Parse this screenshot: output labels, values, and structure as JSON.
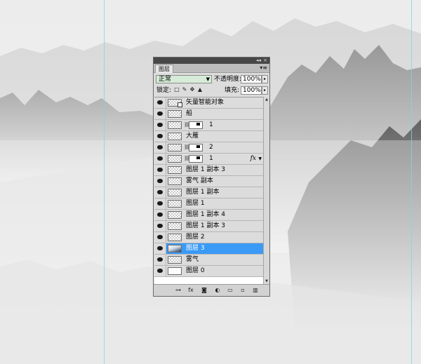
{
  "panel": {
    "tab_label": "图层",
    "collapse_glyph": "◂◂",
    "close_glyph": "×",
    "menu_glyph": "▾≡",
    "blend_mode": "正常",
    "opacity_label": "不透明度:",
    "opacity_value": "100%",
    "lock_label": "锁定:",
    "fill_label": "填充:",
    "fill_value": "100%"
  },
  "icons": {
    "lock_transparent": "□",
    "lock_paint": "✎",
    "lock_move": "✥",
    "lock_all": "▲",
    "bottom": [
      "⊶",
      "fx",
      "◙",
      "◐",
      "▭",
      "▫",
      "▥"
    ]
  },
  "layers": [
    {
      "name": "矢量智能对象",
      "type": "smart"
    },
    {
      "name": "船",
      "type": "normal"
    },
    {
      "name": "1",
      "type": "masked"
    },
    {
      "name": "大雁",
      "type": "normal"
    },
    {
      "name": "2",
      "type": "masked"
    },
    {
      "name": "1",
      "type": "masked",
      "fx": "fx"
    },
    {
      "name": "图层 1 副本 3",
      "type": "normal"
    },
    {
      "name": "雾气 副本",
      "type": "normal"
    },
    {
      "name": "图层 1 副本",
      "type": "normal"
    },
    {
      "name": "图层 1",
      "type": "normal"
    },
    {
      "name": "图层 1 副本 4",
      "type": "normal"
    },
    {
      "name": "图层 1 副本 3",
      "type": "normal"
    },
    {
      "name": "图层 2",
      "type": "normal"
    },
    {
      "name": "图层 3",
      "type": "image",
      "selected": true
    },
    {
      "name": "雾气",
      "type": "normal"
    },
    {
      "name": "图层 0",
      "type": "plain"
    }
  ]
}
